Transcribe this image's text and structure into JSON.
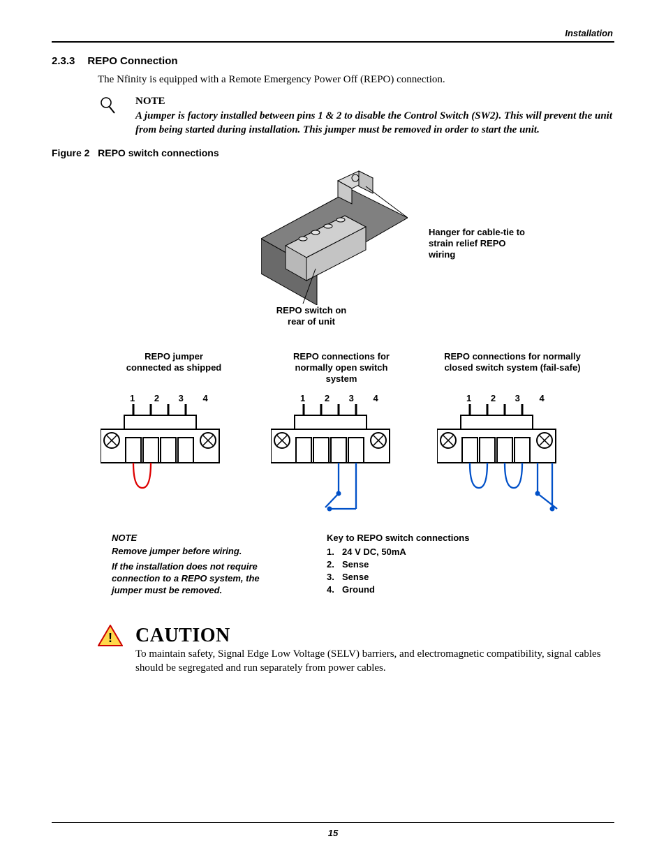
{
  "header": {
    "label": "Installation"
  },
  "section": {
    "number": "2.3.3",
    "title": "REPO Connection"
  },
  "intro": "The Nfinity is equipped with a Remote Emergency Power Off (REPO) connection.",
  "note1": {
    "title": "NOTE",
    "text": "A jumper is factory installed between pins 1 & 2 to disable the Control Switch (SW2). This will prevent the unit from being started during installation. This jumper must be removed in order to start the unit."
  },
  "figure": {
    "caption_prefix": "Figure 2",
    "caption_title": "REPO switch connections",
    "hanger_callout": "Hanger for cable-tie to strain relief REPO wiring",
    "switch_callout": "REPO switch on rear of unit",
    "cols": [
      {
        "title": "REPO jumper connected as shipped",
        "pins": "1 2 3 4"
      },
      {
        "title": "REPO connections for normally open switch system",
        "pins": "1 2 3 4"
      },
      {
        "title": "REPO connections for normally closed switch system (fail-safe)",
        "pins": "1 2 3 4"
      }
    ],
    "panel_note": {
      "title": "NOTE",
      "line1": "Remove jumper before wiring.",
      "line2": "If the installation does not require connection to a REPO system, the jumper must be removed."
    },
    "key": {
      "title": "Key to REPO switch connections",
      "items": [
        {
          "n": "1.",
          "t": "24 V DC, 50mA"
        },
        {
          "n": "2.",
          "t": "Sense"
        },
        {
          "n": "3.",
          "t": "Sense"
        },
        {
          "n": "4.",
          "t": "Ground"
        }
      ]
    }
  },
  "caution": {
    "title": "CAUTION",
    "text": "To maintain safety, Signal Edge Low Voltage (SELV) barriers, and electromagnetic compatibility, signal cables should be segregated and run separately from power cables."
  },
  "page_number": "15"
}
